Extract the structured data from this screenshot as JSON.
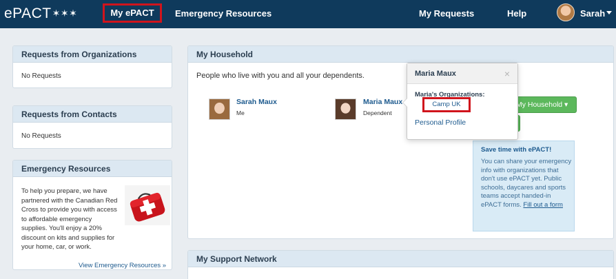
{
  "nav": {
    "logo": "ePACT",
    "logo_stars": "✶✶✶",
    "my_epact": "My ePACT",
    "emergency_resources": "Emergency Resources",
    "my_requests": "My Requests",
    "help": "Help",
    "user_name": "Sarah"
  },
  "sidebar": {
    "requests_orgs": {
      "title": "Requests from Organizations",
      "empty": "No Requests"
    },
    "requests_contacts": {
      "title": "Requests from Contacts",
      "empty": "No Requests"
    },
    "emergency": {
      "title": "Emergency Resources",
      "text": "To help you prepare, we have partnered with the Canadian Red Cross to provide you with access to affordable emergency supplies. You'll enjoy a 20% discount on kits and supplies for your home, car, or work.",
      "link": "View Emergency Resources »"
    }
  },
  "household": {
    "title": "My Household",
    "intro": "People who live with you and all your dependents.",
    "members": [
      {
        "name": "Sarah Maux",
        "relation": "Me"
      },
      {
        "name": "Maria Maux",
        "relation": "Dependent"
      }
    ],
    "button_label": "My Household ▾",
    "save_title": "Save time with ePACT!",
    "save_text": "You can share your emergency info with organizations that don't use ePACT yet. Public schools, daycares and sports teams accept handed-in ePACT forms.",
    "save_link": "Fill out a form"
  },
  "support": {
    "title": "My Support Network"
  },
  "popover": {
    "title": "Maria Maux",
    "close": "×",
    "orgs_label": "Maria's Organizations:",
    "org_item": "Camp UK",
    "profile_link": "Personal Profile"
  },
  "colors": {
    "navbar": "#0f3a5c",
    "panel_header": "#dce8f2",
    "link": "#1d5a8e",
    "highlight_red": "#d0141c",
    "green_button": "#5cb85c"
  }
}
